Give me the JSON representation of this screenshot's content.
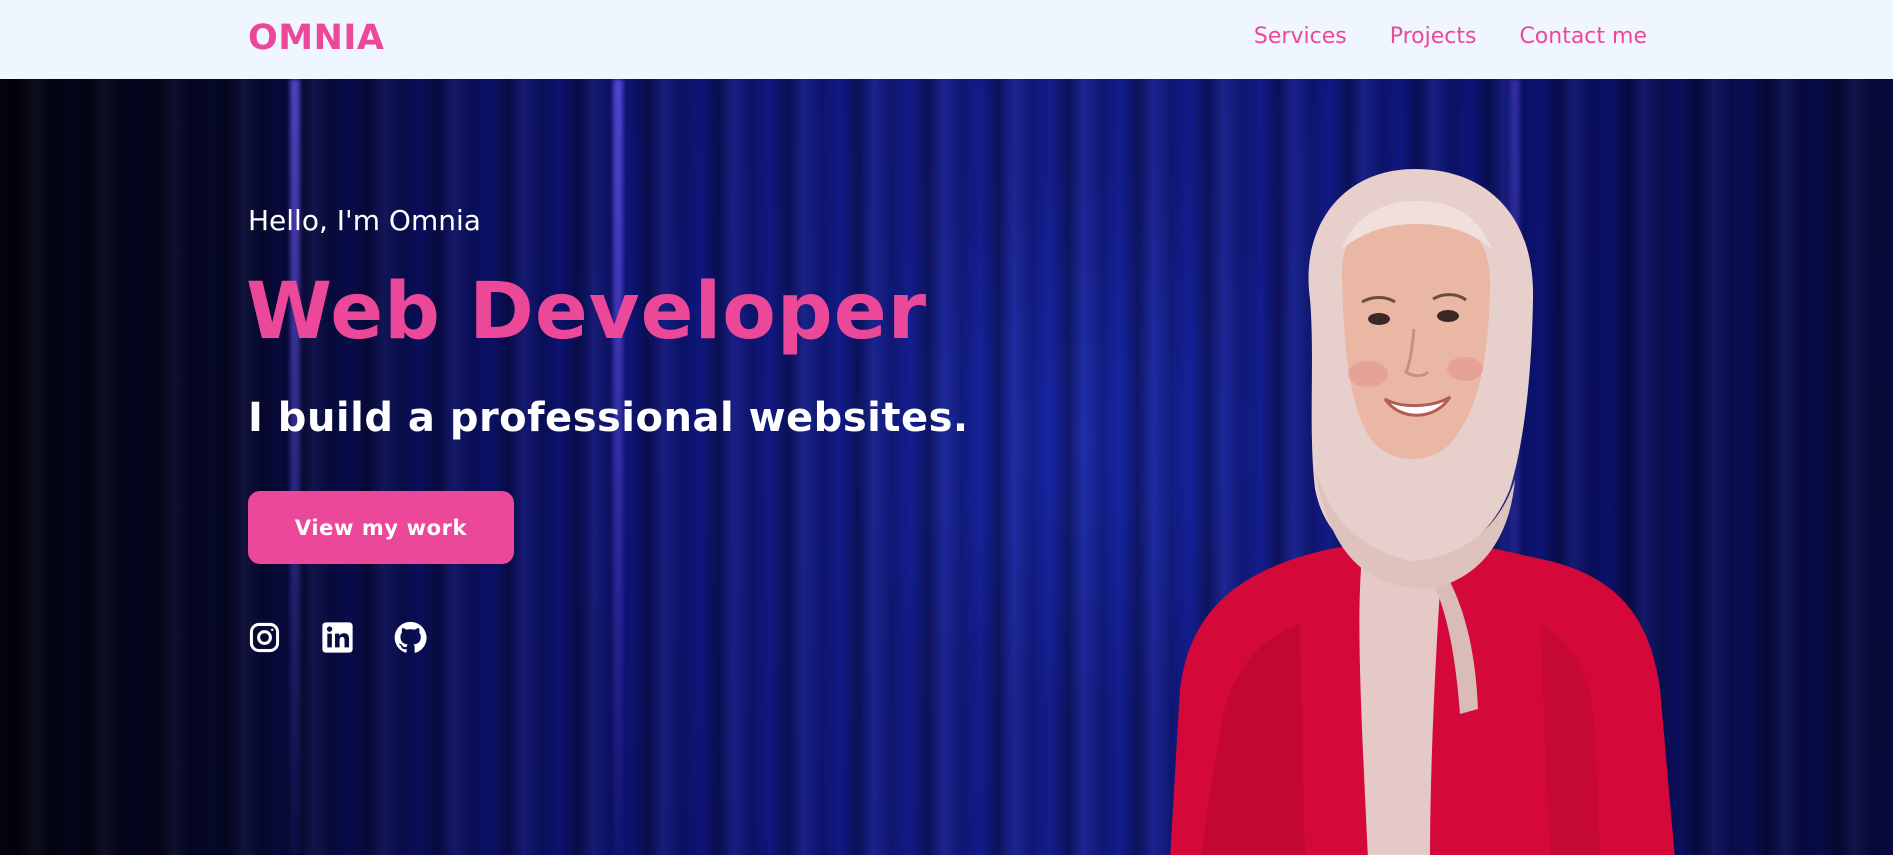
{
  "nav": {
    "brand": "OMNIA",
    "links": [
      "Services",
      "Projects",
      "Contact me"
    ]
  },
  "hero": {
    "greeting": "Hello, I'm Omnia",
    "headline": "Web Developer",
    "subheadline": "I build a professional websites.",
    "cta_label": "View my work",
    "socials": [
      "instagram-icon",
      "linkedin-icon",
      "github-icon"
    ],
    "portrait": "portrait of woman in white hijab and red sweater"
  },
  "colors": {
    "accent": "#ec4899",
    "nav_background": "#eff6ff",
    "hero_background": "#0f157e",
    "text_light": "#ffffff"
  }
}
